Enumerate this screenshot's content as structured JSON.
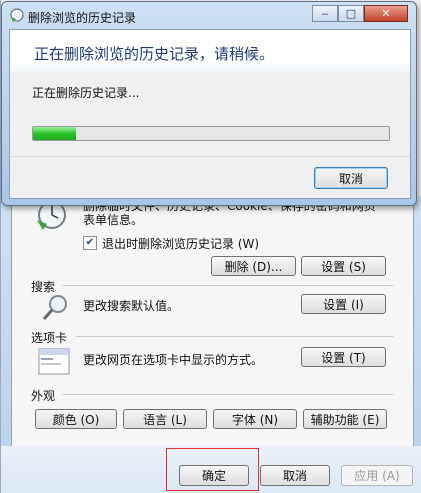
{
  "dialog": {
    "title": "删除浏览的历史记录",
    "heading": "正在删除浏览的历史记录，请稍候。",
    "status": "正在删除历史记录...",
    "progress": 0.12,
    "cancel_label": "取消"
  },
  "history": {
    "description": "删除临时文件、历史记录、Cookie、保存的密码和网页表单信息。",
    "exit_checkbox_label": "退出时删除浏览历史记录 (W)",
    "exit_checkbox_checked": true,
    "delete_label": "删除 (D)...",
    "settings_label": "设置 (S)"
  },
  "search": {
    "section_label": "搜索",
    "description": "更改搜索默认值。",
    "settings_label": "设置 (I)"
  },
  "tabs": {
    "section_label": "选项卡",
    "description": "更改网页在选项卡中显示的方式。",
    "settings_label": "设置 (T)"
  },
  "appearance": {
    "section_label": "外观",
    "colors_label": "颜色 (O)",
    "languages_label": "语言 (L)",
    "fonts_label": "字体 (N)",
    "accessibility_label": "辅助功能 (E)"
  },
  "footer": {
    "ok_label": "确定",
    "cancel_label": "取消",
    "apply_label": "应用 (A)"
  },
  "colors": {
    "heading": "#1e3c78",
    "progress": "#2bc32b",
    "highlight": "#e03030"
  }
}
